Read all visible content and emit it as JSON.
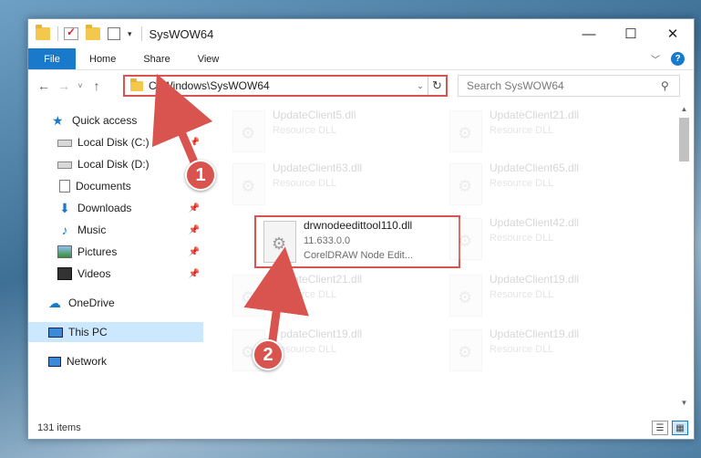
{
  "window": {
    "title": "SysWOW64",
    "controls": {
      "minimize": "—",
      "maximize": "☐",
      "close": "✕"
    }
  },
  "ribbon": {
    "file": "File",
    "tabs": [
      "Home",
      "Share",
      "View"
    ],
    "help": "?"
  },
  "nav": {
    "back": "←",
    "forward": "→",
    "recent": "˅",
    "up": "↑"
  },
  "address": {
    "path": "C:\\Windows\\SysWOW64"
  },
  "search": {
    "placeholder": "Search SysWOW64"
  },
  "sidebar": {
    "items": [
      {
        "label": "Quick access",
        "icon": "star-icon"
      },
      {
        "label": "Local Disk (C:)",
        "icon": "drive-icon"
      },
      {
        "label": "Local Disk (D:)",
        "icon": "drive-icon"
      },
      {
        "label": "Documents",
        "icon": "documents-icon"
      },
      {
        "label": "Downloads",
        "icon": "downloads-icon"
      },
      {
        "label": "Music",
        "icon": "music-icon"
      },
      {
        "label": "Pictures",
        "icon": "pictures-icon"
      },
      {
        "label": "Videos",
        "icon": "videos-icon"
      },
      {
        "label": "OneDrive",
        "icon": "cloud-icon"
      },
      {
        "label": "This PC",
        "icon": "pc-icon"
      },
      {
        "label": "Network",
        "icon": "network-icon"
      }
    ]
  },
  "files": [
    {
      "name": "UpdateClient5.dll",
      "type": "Resource DLL"
    },
    {
      "name": "UpdateClient21.dll",
      "type": "Resource DLL"
    },
    {
      "name": "UpdateClient63.dll",
      "type": "Resource DLL"
    },
    {
      "name": "UpdateClient65.dll",
      "type": "Resource DLL"
    },
    {
      "name": "drwnodeedittool110.dll",
      "version": "11.633.0.0",
      "type": "CorelDRAW Node Edit..."
    },
    {
      "name": "UpdateClient42.dll",
      "type": "Resource DLL"
    },
    {
      "name": "UpdateClient21.dll",
      "type": "Resource DLL"
    },
    {
      "name": "UpdateClient19.dll",
      "type": "Resource DLL"
    },
    {
      "name": "UpdateClient19.dll",
      "type": "Resource DLL"
    },
    {
      "name": "UpdateClient19.dll",
      "type": "Resource DLL"
    }
  ],
  "status": {
    "count": "131 items"
  },
  "annotations": {
    "step1": "1",
    "step2": "2"
  },
  "colors": {
    "accent": "#1979ca",
    "highlight": "#d9534f",
    "selected": "#cce8ff"
  }
}
